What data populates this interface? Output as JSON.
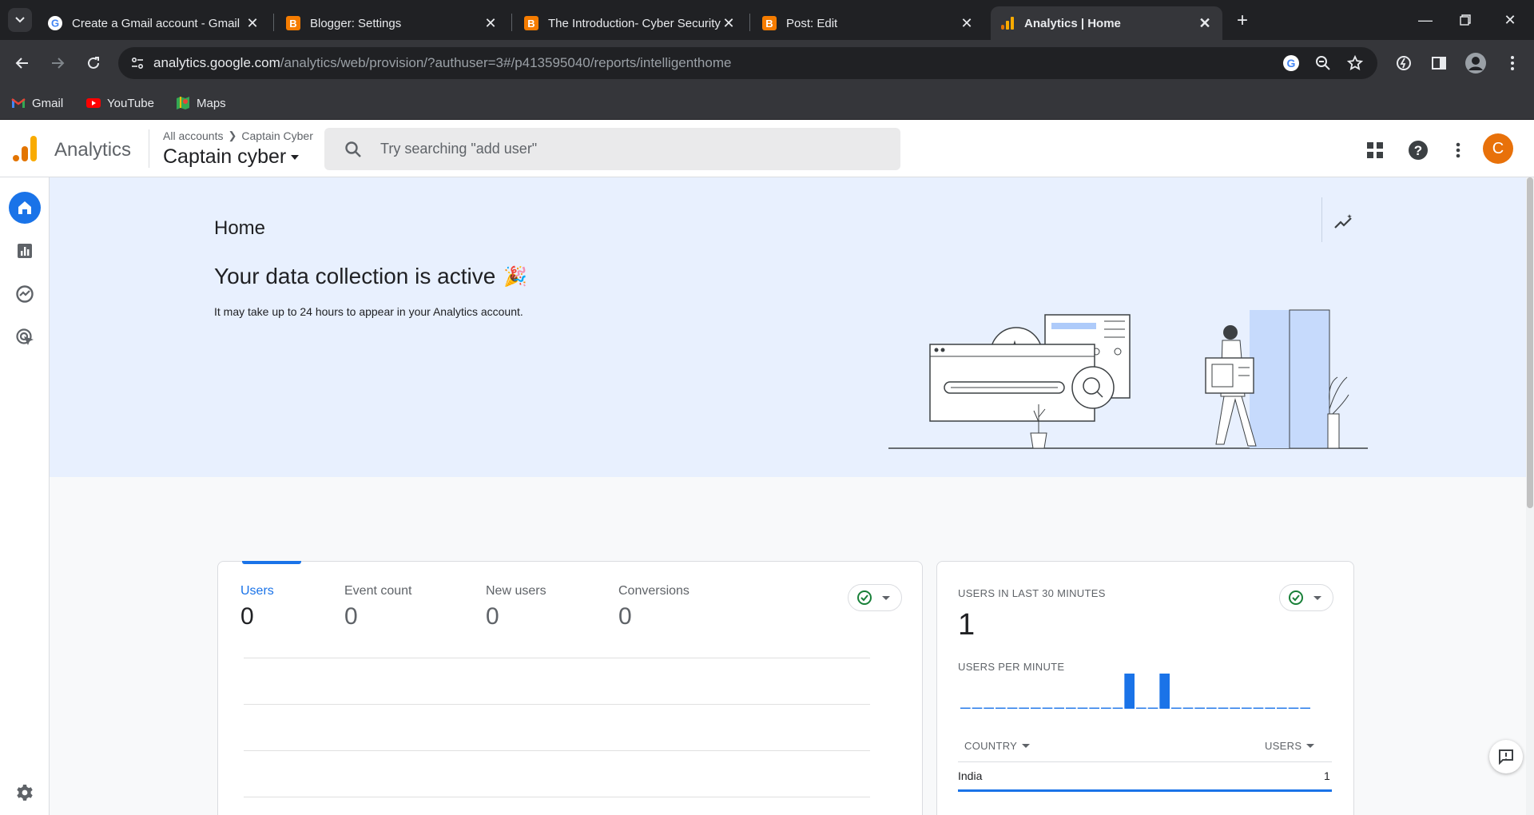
{
  "browser": {
    "tabs": [
      {
        "title": "Create a Gmail account - Gmail",
        "favicon": "google-g-icon"
      },
      {
        "title": "Blogger: Settings",
        "favicon": "blogger-icon"
      },
      {
        "title": "The Introduction- Cyber Security",
        "favicon": "blogger-icon"
      },
      {
        "title": "Post: Edit",
        "favicon": "blogger-icon"
      },
      {
        "title": "Analytics | Home",
        "favicon": "analytics-icon",
        "active": true
      }
    ],
    "url_host": "analytics.google.com",
    "url_path": "/analytics/web/provision/?authuser=3#/p413595040/reports/intelligenthome",
    "bookmarks": [
      {
        "label": "Gmail",
        "icon": "gmail-icon"
      },
      {
        "label": "YouTube",
        "icon": "youtube-icon"
      },
      {
        "label": "Maps",
        "icon": "maps-icon"
      }
    ]
  },
  "header": {
    "product": "Analytics",
    "breadcrumb_root": "All accounts",
    "breadcrumb_account": "Captain Cyber",
    "property": "Captain cyber",
    "search_placeholder": "Try searching \"add user\"",
    "avatar_letter": "C"
  },
  "hero": {
    "title": "Home",
    "heading": "Your data collection is active",
    "heading_emoji": "🎉",
    "subtext": "It may take up to 24 hours to appear in your Analytics account."
  },
  "metrics": [
    {
      "label": "Users",
      "value": "0"
    },
    {
      "label": "Event count",
      "value": "0"
    },
    {
      "label": "New users",
      "value": "0"
    },
    {
      "label": "Conversions",
      "value": "0"
    }
  ],
  "realtime": {
    "title": "USERS IN LAST 30 MINUTES",
    "value": "1",
    "per_minute_label": "USERS PER MINUTE",
    "per_minute": [
      0,
      0,
      0,
      0,
      0,
      0,
      0,
      0,
      0,
      0,
      0,
      0,
      0,
      0,
      1,
      0,
      0,
      1,
      0,
      0,
      0,
      0,
      0,
      0,
      0,
      0,
      0,
      0,
      0,
      0
    ],
    "col_country": "COUNTRY",
    "col_users": "USERS",
    "rows": [
      {
        "country": "India",
        "users": "1"
      }
    ]
  },
  "colors": {
    "accent": "#1a73e8",
    "hero_bg": "#e8f0fe",
    "avatar": "#e8710a"
  }
}
